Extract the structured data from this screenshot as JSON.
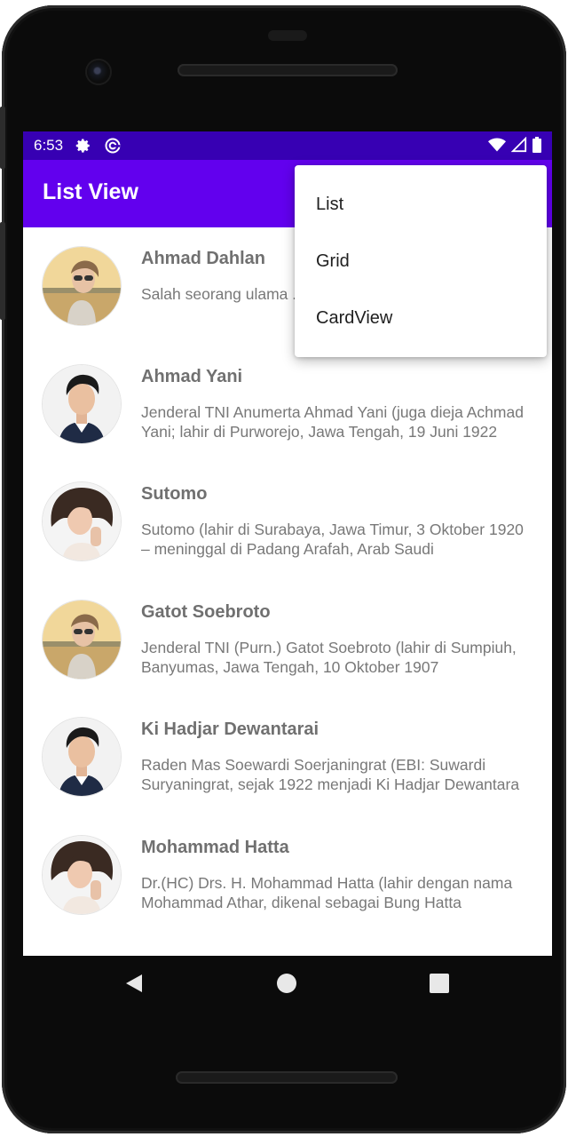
{
  "status_bar": {
    "time": "6:53",
    "icons": [
      "settings-icon",
      "sync-icon",
      "wifi-icon",
      "signal-icon",
      "battery-icon"
    ]
  },
  "app_bar": {
    "title": "List View"
  },
  "menu": {
    "items": [
      {
        "label": "List"
      },
      {
        "label": "Grid"
      },
      {
        "label": "CardView"
      }
    ]
  },
  "list": {
    "items": [
      {
        "name": "Ahmad Dahlan",
        "description": "Salah seorang ulama ... di Masjid Besar Kauman",
        "avatar": "woman-sunglasses-photo"
      },
      {
        "name": "Ahmad Yani",
        "description": "Jenderal TNI Anumerta Ahmad Yani (juga dieja Achmad Yani; lahir di Purworejo, Jawa Tengah, 19 Juni 1922",
        "avatar": "man-portrait-photo"
      },
      {
        "name": "Sutomo",
        "description": "Sutomo (lahir di Surabaya, Jawa Timur, 3 Oktober 1920 – meninggal di Padang Arafah, Arab Saudi",
        "avatar": "woman-curly-hair-photo"
      },
      {
        "name": "Gatot Soebroto",
        "description": "Jenderal TNI (Purn.) Gatot Soebroto (lahir di Sumpiuh, Banyumas, Jawa Tengah, 10 Oktober 1907",
        "avatar": "woman-sunglasses-photo"
      },
      {
        "name": "Ki Hadjar Dewantarai",
        "description": "Raden Mas Soewardi Soerjaningrat (EBI: Suwardi Suryaningrat, sejak 1922 menjadi Ki Hadjar Dewantara",
        "avatar": "man-portrait-photo"
      },
      {
        "name": "Mohammad Hatta",
        "description": "Dr.(HC) Drs. H. Mohammad Hatta (lahir dengan nama Mohammad Athar, dikenal sebagai Bung Hatta",
        "avatar": "woman-curly-hair-photo"
      }
    ]
  },
  "colors": {
    "status_bar": "#3700b3",
    "app_bar": "#6200ee",
    "title_text": "#707070",
    "body_text": "#787878"
  },
  "nav_bar": {
    "icons": [
      "back-icon",
      "home-icon",
      "recents-icon"
    ]
  }
}
